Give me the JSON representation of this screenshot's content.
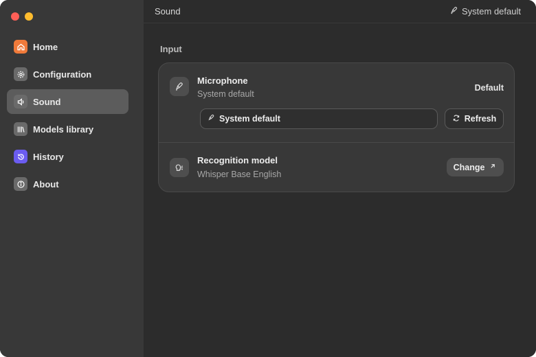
{
  "window": {
    "traffic_lights": [
      "red",
      "yellow"
    ]
  },
  "sidebar": {
    "items": [
      {
        "label": "Home",
        "icon": "home-icon",
        "color": "#f07a3a",
        "active": false
      },
      {
        "label": "Configuration",
        "icon": "gear-icon",
        "color": "#6a6a6a",
        "active": false
      },
      {
        "label": "Sound",
        "icon": "speaker-icon",
        "color": "#6a6a6a",
        "active": true
      },
      {
        "label": "Models library",
        "icon": "library-icon",
        "color": "#6a6a6a",
        "active": false
      },
      {
        "label": "History",
        "icon": "history-icon",
        "color": "#6b5cf0",
        "active": false
      },
      {
        "label": "About",
        "icon": "info-icon",
        "color": "#6a6a6a",
        "active": false
      }
    ]
  },
  "topbar": {
    "title": "Sound",
    "status": "System default",
    "status_icon": "microphone-icon"
  },
  "main": {
    "section_title": "Input",
    "microphone": {
      "title": "Microphone",
      "subtitle": "System default",
      "value": "Default",
      "select_value": "System default",
      "refresh_label": "Refresh"
    },
    "recognition": {
      "title": "Recognition model",
      "subtitle": "Whisper Base English",
      "change_label": "Change"
    }
  },
  "colors": {
    "sidebar_bg": "#383838",
    "main_bg": "#2c2c2c",
    "card_bg": "#383838",
    "active_item": "#5c5c5c"
  }
}
